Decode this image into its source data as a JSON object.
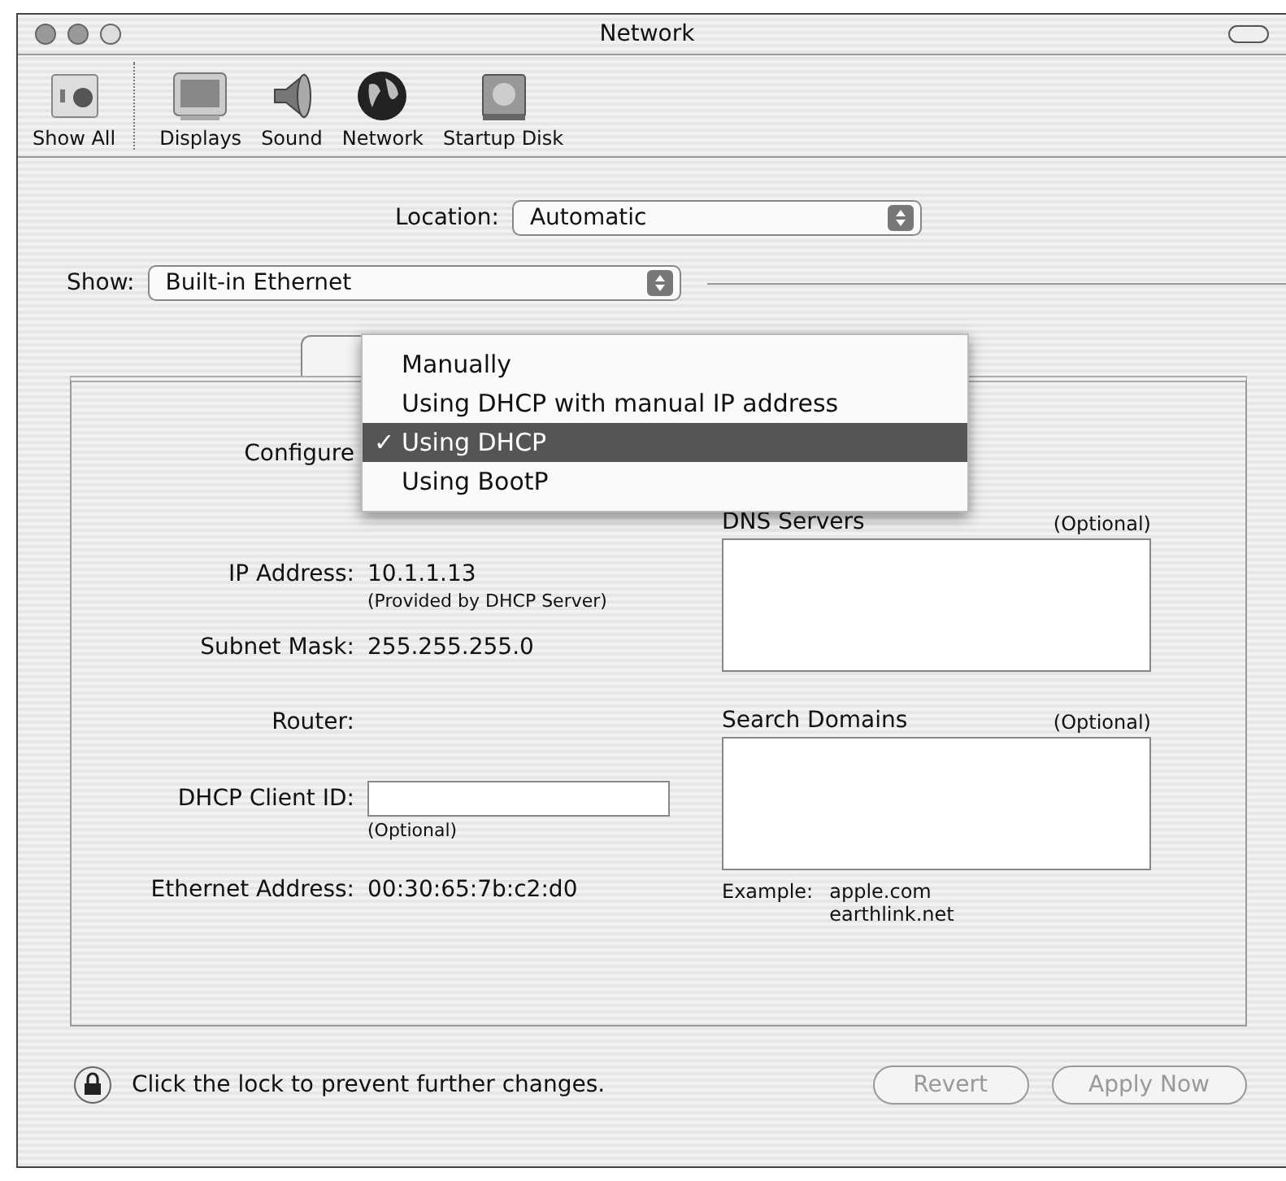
{
  "window": {
    "title": "Network"
  },
  "toolbar": [
    {
      "label": "Show All",
      "kind": "showall"
    },
    {
      "label": "Displays",
      "kind": "display"
    },
    {
      "label": "Sound",
      "kind": "speaker"
    },
    {
      "label": "Network",
      "kind": "globe"
    },
    {
      "label": "Startup Disk",
      "kind": "disk"
    }
  ],
  "location": {
    "label": "Location:",
    "value": "Automatic"
  },
  "show": {
    "label": "Show:",
    "value": "Built-in Ethernet"
  },
  "configure": {
    "label": "Configure",
    "check": "✓",
    "menu": [
      {
        "label": "Manually",
        "selected": false
      },
      {
        "label": "Using DHCP with manual IP address",
        "selected": false
      },
      {
        "label": "Using DHCP",
        "selected": true
      },
      {
        "label": "Using BootP",
        "selected": false
      }
    ]
  },
  "fields": [
    {
      "label": "IP Address:",
      "kind": "text",
      "value": "10.1.1.13",
      "note": "(Provided by DHCP Server)"
    },
    {
      "label": "Subnet Mask:",
      "kind": "text",
      "value": "255.255.255.0"
    },
    {
      "label": "Router:",
      "kind": "text"
    },
    {
      "label": "DHCP Client ID:",
      "kind": "input",
      "note": "(Optional)"
    },
    {
      "label": "Ethernet Address:",
      "kind": "text",
      "value": "00:30:65:7b:c2:d0"
    }
  ],
  "dns": {
    "title": "DNS Servers",
    "note": "(Optional)"
  },
  "search_domains": {
    "title": "Search Domains",
    "note": "(Optional)"
  },
  "example": {
    "label": "Example:",
    "lines": [
      "apple.com",
      "earthlink.net"
    ]
  },
  "footer": {
    "lock_text": "Click the lock to prevent further changes.",
    "buttons": [
      {
        "label": "Revert",
        "disabled": true
      },
      {
        "label": "Apply Now",
        "disabled": true
      }
    ]
  }
}
